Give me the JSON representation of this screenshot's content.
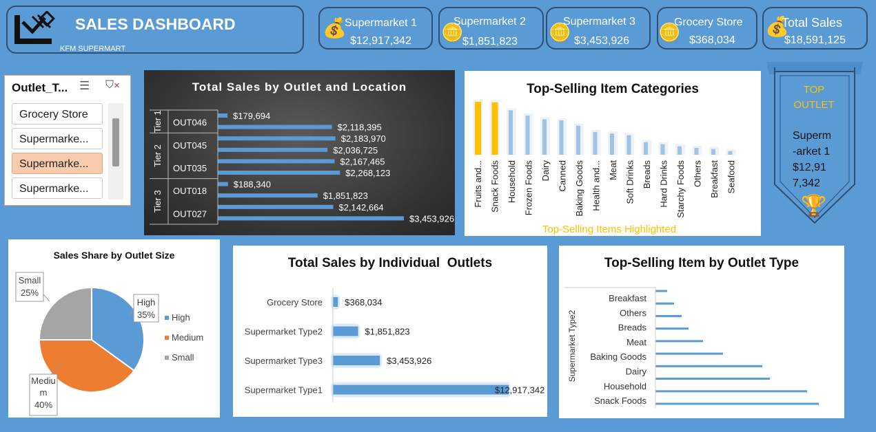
{
  "header": {
    "title": "SALES DASHBOARD",
    "subtitle": "KFM SUPERMART"
  },
  "kpis": [
    {
      "label": "Supermarket 1",
      "value": "$12,917,342"
    },
    {
      "label": "Supermarket 2",
      "value": "$1,851,823"
    },
    {
      "label": "Supermarket 3",
      "value": "$3,453,926"
    },
    {
      "label": "Grocery Store",
      "value": "$368,034"
    },
    {
      "label": "Total Sales",
      "value": "$18,591,125"
    }
  ],
  "slicer": {
    "title": "Outlet_T...",
    "items": [
      "Grocery Store",
      "Supermarke...",
      "Supermarke...",
      "Supermarke..."
    ],
    "selected_index": 2
  },
  "top_outlet": {
    "label": "TOP OUTLET",
    "name": "Superm-arket 1",
    "value": "$12,917,342"
  },
  "colors": {
    "accent": "#5b9bd5",
    "bar": "#5b9bd5",
    "highlight": "#ffc000",
    "medium": "#ed7d31",
    "small": "#a5a5a5"
  },
  "chart_data": [
    {
      "type": "bar",
      "title": "Total Sales by Outlet and Location",
      "groups": [
        {
          "tier": "Tier 1",
          "outlets": [
            "OUT046"
          ]
        },
        {
          "tier": "Tier 2",
          "outlets": [
            "OUT045",
            "OUT035"
          ]
        },
        {
          "tier": "Tier 3",
          "outlets": [
            "OUT018",
            "OUT027"
          ]
        }
      ],
      "values": [
        179694,
        2118395,
        2183970,
        2036725,
        2167465,
        2268123,
        188340,
        1851823,
        2142664,
        3453926
      ],
      "labels": [
        "$179,694",
        "$2,118,395",
        "$2,183,970",
        "$2,036,725",
        "$2,167,465",
        "$2,268,123",
        "$188,340",
        "$1,851,823",
        "$2,142,664",
        "$3,453,926"
      ]
    },
    {
      "type": "bar",
      "title": "Top-Selling Item Categories",
      "categories": [
        "Fruits and...",
        "Snack Foods",
        "Household",
        "Frozen Foods",
        "Dairy",
        "Canned",
        "Baking Goods",
        "Health and...",
        "Meat",
        "Soft Drinks",
        "Breads",
        "Hard Drinks",
        "Starchy Foods",
        "Others",
        "Breakfast",
        "Seafood"
      ],
      "values": [
        100,
        99,
        84,
        74,
        67,
        65,
        55,
        43,
        40,
        37,
        24,
        20,
        16,
        13,
        11,
        7
      ],
      "highlighted": [
        0,
        1
      ],
      "caption": "Top-Selling Items Highlighted"
    },
    {
      "type": "pie",
      "title": "Sales Share by Outlet Size",
      "slices": [
        {
          "name": "High",
          "pct": "35%",
          "value": 35
        },
        {
          "name": "Medium",
          "pct": "40%",
          "value": 40
        },
        {
          "name": "Small",
          "pct": "25%",
          "value": 25
        }
      ]
    },
    {
      "type": "bar",
      "title": "Total Sales by Individual  Outlets",
      "categories": [
        "Grocery Store",
        "Supermarket Type2",
        "Supermarket Type3",
        "Supermarket Type1"
      ],
      "values": [
        368034,
        1851823,
        3453926,
        12917342
      ],
      "labels": [
        "$368,034",
        "$1,851,823",
        "$3,453,926",
        "$12,917,342"
      ]
    },
    {
      "type": "bar",
      "title": "Top-Selling Item by Outlet Type",
      "ylabel": "Supermarket Type2",
      "category_labels": [
        "Breakfast",
        "Others",
        "Breads",
        "Meat",
        "Baking Goods",
        "Dairy",
        "Household",
        "Snack Foods"
      ],
      "values": [
        17,
        27,
        38,
        48,
        69,
        98,
        155,
        166,
        220,
        237
      ]
    }
  ]
}
